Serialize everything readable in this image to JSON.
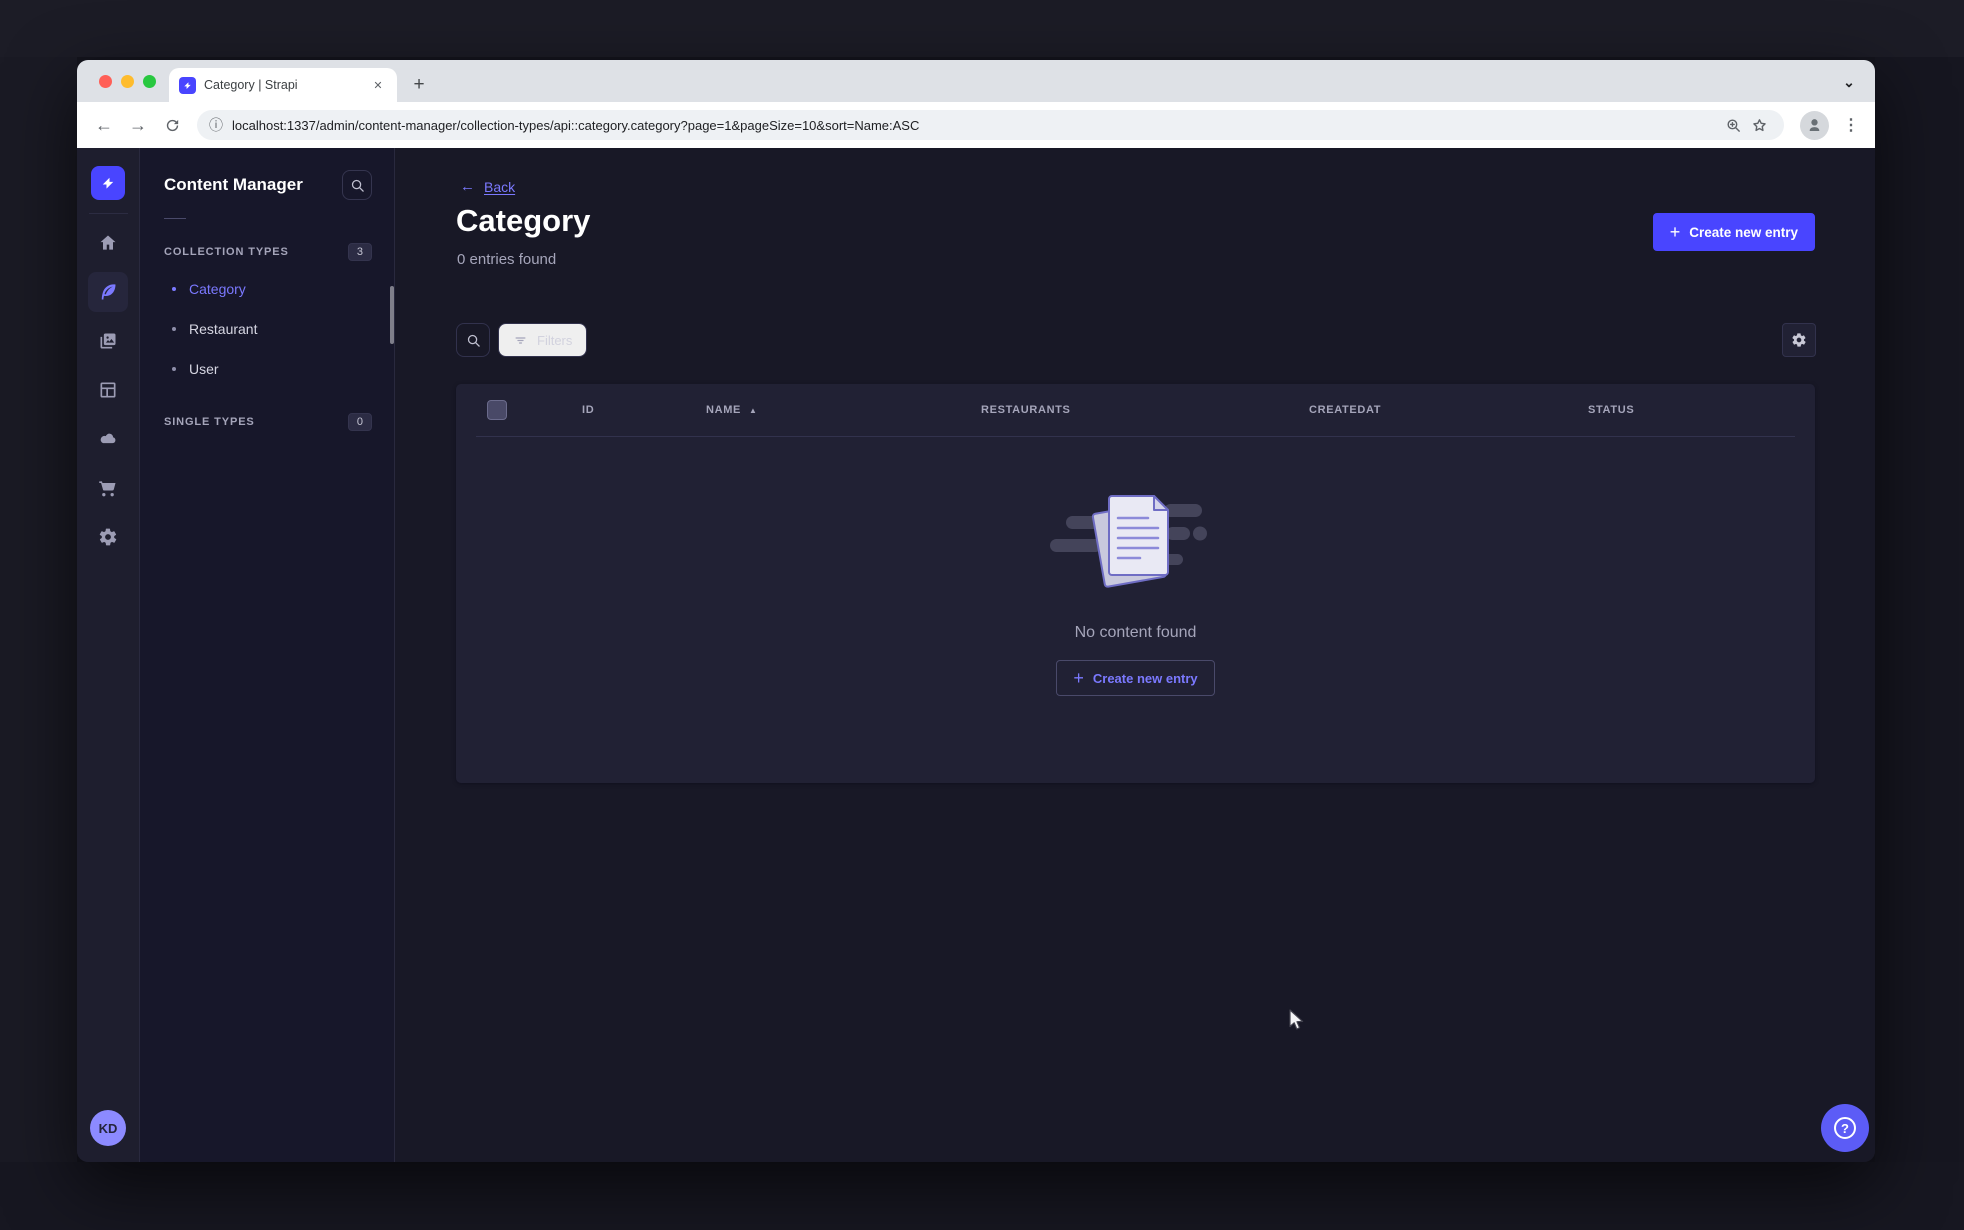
{
  "browser": {
    "tab_title": "Category | Strapi",
    "url": "localhost:1337/admin/content-manager/collection-types/api::category.category?page=1&pageSize=10&sort=Name:ASC"
  },
  "icons": {
    "close": "✕",
    "plus": "+",
    "chevron_down": "⌄",
    "kebab": "⋮",
    "back_arrow": "←",
    "forward_arrow": "→",
    "info": "ⓘ",
    "sort_asc": "▲",
    "question_mark": "?"
  },
  "rail": {
    "avatar_initials": "KD"
  },
  "subnav": {
    "title": "Content Manager",
    "collection_types": {
      "label": "COLLECTION TYPES",
      "badge": "3",
      "items": [
        {
          "label": "Category",
          "active": true
        },
        {
          "label": "Restaurant",
          "active": false
        },
        {
          "label": "User",
          "active": false
        }
      ]
    },
    "single_types": {
      "label": "SINGLE TYPES",
      "badge": "0"
    }
  },
  "main": {
    "back_label": "Back",
    "title": "Category",
    "subtitle": "0 entries found",
    "create_button_label": "Create new entry",
    "filters_button_label": "Filters",
    "table": {
      "columns": [
        "ID",
        "NAME",
        "RESTAURANTS",
        "CREATEDAT",
        "STATUS"
      ],
      "sorted_column": "NAME",
      "sort_direction": "ASC",
      "rows": []
    },
    "empty_state": {
      "message": "No content found",
      "create_button_label": "Create new entry"
    }
  },
  "colors": {
    "primary": "#4945ff",
    "primary_light": "#7b79ff",
    "app_background": "#181826",
    "surface": "#212134"
  }
}
